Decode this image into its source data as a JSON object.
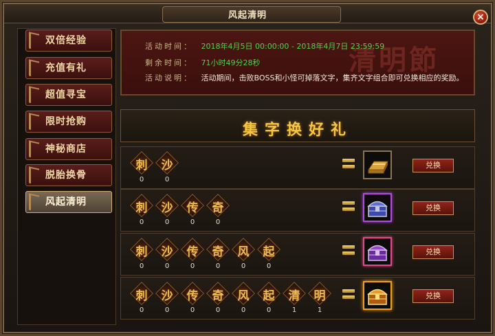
{
  "window": {
    "title": "风起清明",
    "close_label": "×"
  },
  "sidebar": {
    "items": [
      {
        "label": "双倍经验",
        "active": false
      },
      {
        "label": "充值有礼",
        "active": false
      },
      {
        "label": "超值寻宝",
        "active": false
      },
      {
        "label": "限时抢购",
        "active": false
      },
      {
        "label": "神秘商店",
        "active": false
      },
      {
        "label": "脱胎换骨",
        "active": false
      },
      {
        "label": "风起清明",
        "active": true
      }
    ]
  },
  "banner": {
    "decoration_text": "清明節",
    "time_label": "活动时间：",
    "time_value": "2018年4月5日 00:00:00 - 2018年4月7日 23:59:59",
    "remaining_label": "剩余时间：",
    "remaining_value": "71小时49分28秒",
    "desc_label": "活动说明：",
    "desc_value": "活动期间，击败BOSS和小怪可掉落文字，集齐文字组合即可兑换相应的奖励。"
  },
  "section": {
    "title": "集字换好礼"
  },
  "rows": [
    {
      "chars": [
        {
          "char": "刺",
          "count": "0"
        },
        {
          "char": "沙",
          "count": "0"
        }
      ],
      "reward_icon": "gold-bar-icon",
      "reward_frame": "plain",
      "button_label": "兑换"
    },
    {
      "chars": [
        {
          "char": "刺",
          "count": "0"
        },
        {
          "char": "沙",
          "count": "0"
        },
        {
          "char": "传",
          "count": "0"
        },
        {
          "char": "奇",
          "count": "0"
        }
      ],
      "reward_icon": "blue-chest-icon",
      "reward_frame": "purple",
      "button_label": "兑换"
    },
    {
      "chars": [
        {
          "char": "刺",
          "count": "0"
        },
        {
          "char": "沙",
          "count": "0"
        },
        {
          "char": "传",
          "count": "0"
        },
        {
          "char": "奇",
          "count": "0"
        },
        {
          "char": "风",
          "count": "0"
        },
        {
          "char": "起",
          "count": "0"
        }
      ],
      "reward_icon": "purple-chest-icon",
      "reward_frame": "pink",
      "button_label": "兑换"
    },
    {
      "chars": [
        {
          "char": "刺",
          "count": "0"
        },
        {
          "char": "沙",
          "count": "0"
        },
        {
          "char": "传",
          "count": "0"
        },
        {
          "char": "奇",
          "count": "0"
        },
        {
          "char": "风",
          "count": "0"
        },
        {
          "char": "起",
          "count": "0"
        },
        {
          "char": "清",
          "count": "1"
        },
        {
          "char": "明",
          "count": "1"
        }
      ],
      "reward_icon": "golden-chest-icon",
      "reward_frame": "gold",
      "button_label": "兑换"
    }
  ],
  "colors": {
    "accent_gold": "#f5c642",
    "sidebar_red": "#5a1d1a",
    "time_green": "#4fd24a",
    "button_red": "#8e2418"
  }
}
